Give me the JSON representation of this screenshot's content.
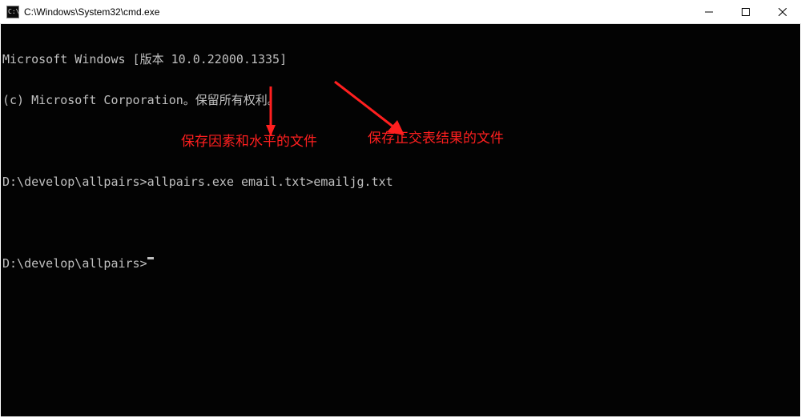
{
  "titlebar": {
    "title": "C:\\Windows\\System32\\cmd.exe"
  },
  "terminal": {
    "line1": "Microsoft Windows [版本 10.0.22000.1335]",
    "line2": "(c) Microsoft Corporation。保留所有权利。",
    "prompt1": "D:\\develop\\allpairs>",
    "command1": "allpairs.exe email.txt>emailjg.txt",
    "prompt2": "D:\\develop\\allpairs>"
  },
  "annotations": {
    "left": "保存因素和水平的文件",
    "right": "保存正交表结果的文件"
  }
}
